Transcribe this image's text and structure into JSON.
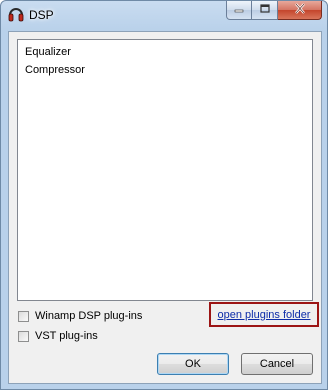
{
  "window": {
    "title": "DSP"
  },
  "plugins": {
    "items": [
      "Equalizer",
      "Compressor"
    ]
  },
  "options": {
    "winamp_dsp": {
      "label": "Winamp DSP plug-ins",
      "checked": false
    },
    "vst": {
      "label": "VST plug-ins",
      "checked": false
    }
  },
  "link": {
    "label": "open plugins folder"
  },
  "buttons": {
    "ok": "OK",
    "cancel": "Cancel"
  },
  "colors": {
    "link": "#0d2ca8",
    "highlight_border": "#9c1515"
  },
  "icons": {
    "app": "headphones-icon",
    "minimize": "minimize-icon",
    "maximize": "maximize-icon",
    "close": "close-icon"
  }
}
